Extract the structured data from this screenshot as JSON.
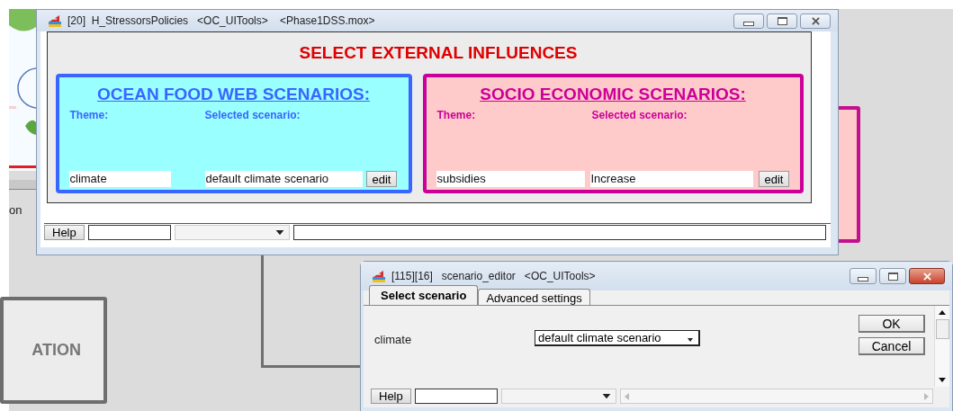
{
  "desktop": {
    "partial_label": "on",
    "box_label": "ATION"
  },
  "main_window": {
    "title": "[20]  H_StressorsPolicies   <OC_UITools>    <Phase1DSS.mox>",
    "heading": "SELECT EXTERNAL INFLUENCES",
    "panels": [
      {
        "kind": "food_web",
        "title": "OCEAN FOOD WEB SCENARIOS:",
        "theme_label": "Theme:",
        "scenario_label": "Selected scenario:",
        "theme": "climate",
        "scenario": "default climate scenario",
        "button": "edit"
      },
      {
        "kind": "socio_economic",
        "title": "SOCIO ECONOMIC SCENARIOS:",
        "theme_label": "Theme:",
        "scenario_label": "Selected scenario:",
        "theme": "subsidies",
        "scenario": "Increase",
        "button": "edit"
      }
    ],
    "status_bar": {
      "help_button": "Help"
    }
  },
  "editor_window": {
    "title": "[115][16]   scenario_editor   <OC_UITools>",
    "tabs": [
      {
        "label": "Select  scenario",
        "selected": true
      },
      {
        "label": "Advanced settings",
        "selected": false
      }
    ],
    "field_label": "climate",
    "scenario": "default climate scenario",
    "buttons": [
      "OK",
      "Cancel"
    ],
    "status_bar": {
      "help_button": "Help"
    }
  }
}
